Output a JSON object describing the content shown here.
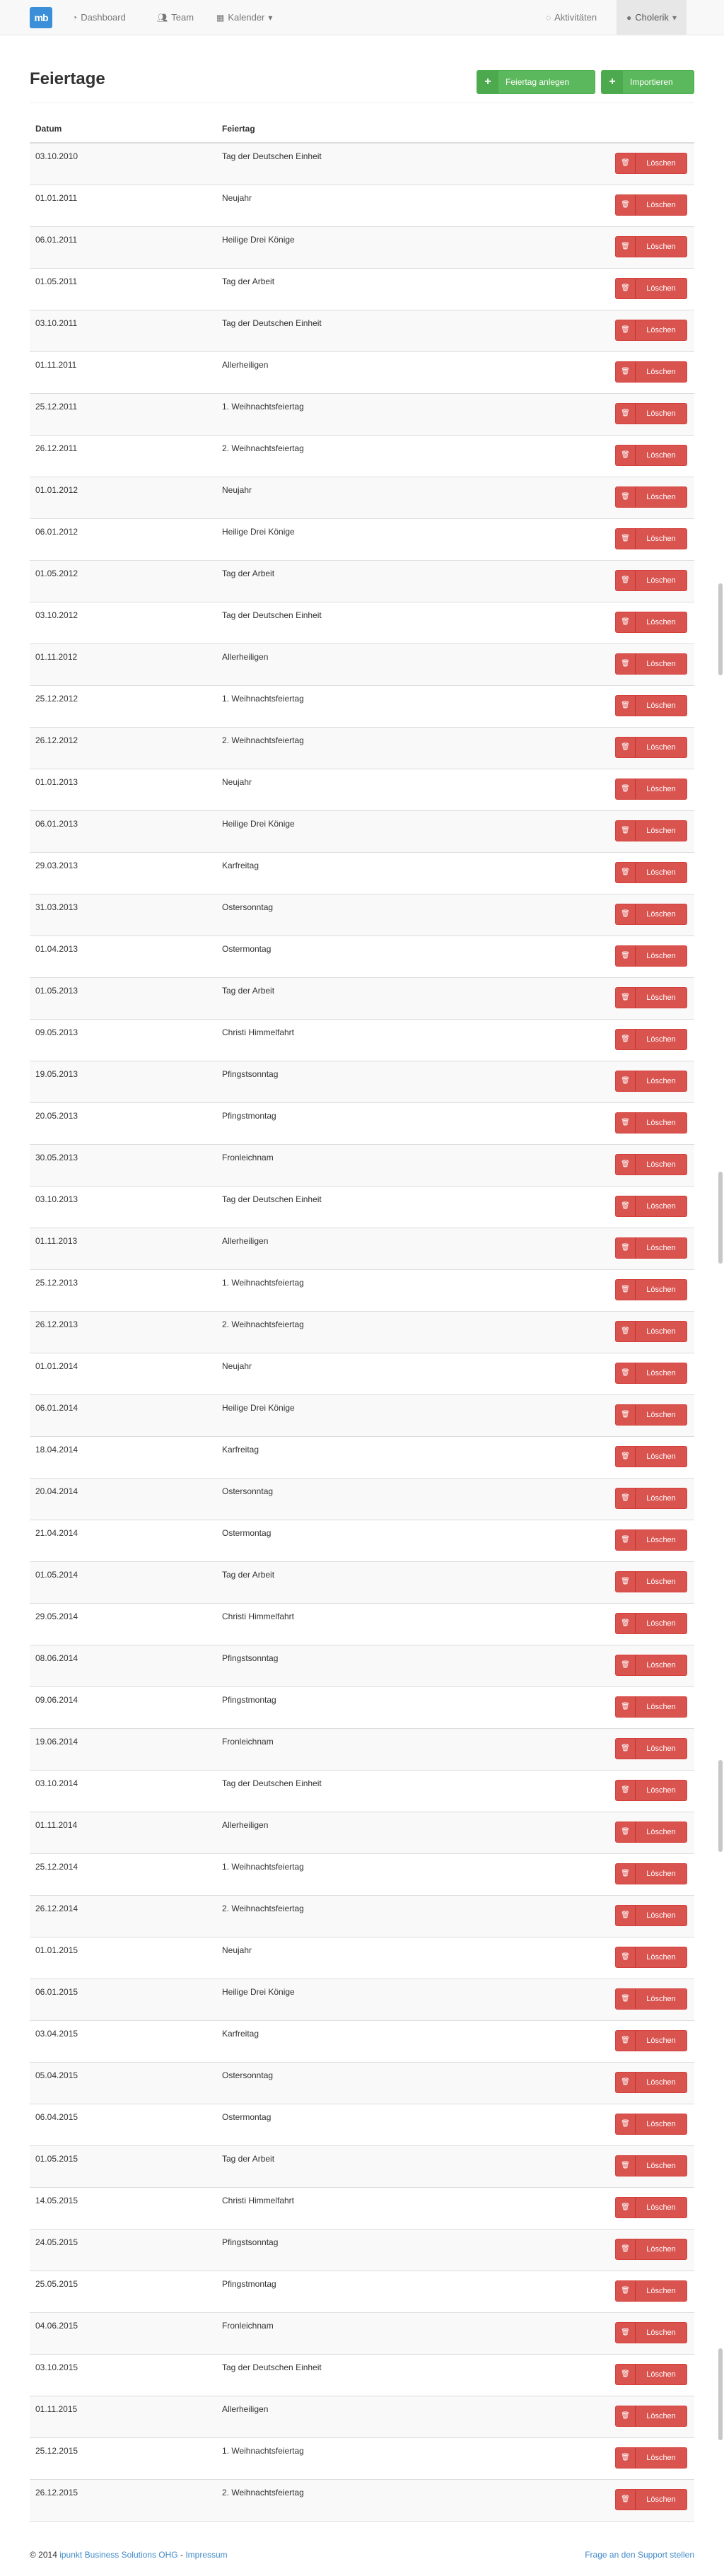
{
  "brand": {
    "logo": "mb"
  },
  "nav": {
    "dashboard": "Dashboard",
    "team": "Team",
    "kalender": "Kalender",
    "aktivitaeten": "Aktivitäten",
    "user": "Cholerik"
  },
  "page": {
    "title": "Feiertage",
    "btn_add": "Feiertag anlegen",
    "btn_import": "Importieren"
  },
  "table": {
    "col_date": "Datum",
    "col_name": "Feiertag",
    "delete_label": "Löschen",
    "rows": [
      [
        "03.10.2010",
        "Tag der Deutschen Einheit"
      ],
      [
        "01.01.2011",
        "Neujahr"
      ],
      [
        "06.01.2011",
        "Heilige Drei Könige"
      ],
      [
        "01.05.2011",
        "Tag der Arbeit"
      ],
      [
        "03.10.2011",
        "Tag der Deutschen Einheit"
      ],
      [
        "01.11.2011",
        "Allerheiligen"
      ],
      [
        "25.12.2011",
        "1. Weihnachtsfeiertag"
      ],
      [
        "26.12.2011",
        "2. Weihnachtsfeiertag"
      ],
      [
        "01.01.2012",
        "Neujahr"
      ],
      [
        "06.01.2012",
        "Heilige Drei Könige"
      ],
      [
        "01.05.2012",
        "Tag der Arbeit"
      ],
      [
        "03.10.2012",
        "Tag der Deutschen Einheit"
      ],
      [
        "01.11.2012",
        "Allerheiligen"
      ],
      [
        "25.12.2012",
        "1. Weihnachtsfeiertag"
      ],
      [
        "26.12.2012",
        "2. Weihnachtsfeiertag"
      ],
      [
        "01.01.2013",
        "Neujahr"
      ],
      [
        "06.01.2013",
        "Heilige Drei Könige"
      ],
      [
        "29.03.2013",
        "Karfreitag"
      ],
      [
        "31.03.2013",
        "Ostersonntag"
      ],
      [
        "01.04.2013",
        "Ostermontag"
      ],
      [
        "01.05.2013",
        "Tag der Arbeit"
      ],
      [
        "09.05.2013",
        "Christi Himmelfahrt"
      ],
      [
        "19.05.2013",
        "Pfingstsonntag"
      ],
      [
        "20.05.2013",
        "Pfingstmontag"
      ],
      [
        "30.05.2013",
        "Fronleichnam"
      ],
      [
        "03.10.2013",
        "Tag der Deutschen Einheit"
      ],
      [
        "01.11.2013",
        "Allerheiligen"
      ],
      [
        "25.12.2013",
        "1. Weihnachtsfeiertag"
      ],
      [
        "26.12.2013",
        "2. Weihnachtsfeiertag"
      ],
      [
        "01.01.2014",
        "Neujahr"
      ],
      [
        "06.01.2014",
        "Heilige Drei Könige"
      ],
      [
        "18.04.2014",
        "Karfreitag"
      ],
      [
        "20.04.2014",
        "Ostersonntag"
      ],
      [
        "21.04.2014",
        "Ostermontag"
      ],
      [
        "01.05.2014",
        "Tag der Arbeit"
      ],
      [
        "29.05.2014",
        "Christi Himmelfahrt"
      ],
      [
        "08.06.2014",
        "Pfingstsonntag"
      ],
      [
        "09.06.2014",
        "Pfingstmontag"
      ],
      [
        "19.06.2014",
        "Fronleichnam"
      ],
      [
        "03.10.2014",
        "Tag der Deutschen Einheit"
      ],
      [
        "01.11.2014",
        "Allerheiligen"
      ],
      [
        "25.12.2014",
        "1. Weihnachtsfeiertag"
      ],
      [
        "26.12.2014",
        "2. Weihnachtsfeiertag"
      ],
      [
        "01.01.2015",
        "Neujahr"
      ],
      [
        "06.01.2015",
        "Heilige Drei Könige"
      ],
      [
        "03.04.2015",
        "Karfreitag"
      ],
      [
        "05.04.2015",
        "Ostersonntag"
      ],
      [
        "06.04.2015",
        "Ostermontag"
      ],
      [
        "01.05.2015",
        "Tag der Arbeit"
      ],
      [
        "14.05.2015",
        "Christi Himmelfahrt"
      ],
      [
        "24.05.2015",
        "Pfingstsonntag"
      ],
      [
        "25.05.2015",
        "Pfingstmontag"
      ],
      [
        "04.06.2015",
        "Fronleichnam"
      ],
      [
        "03.10.2015",
        "Tag der Deutschen Einheit"
      ],
      [
        "01.11.2015",
        "Allerheiligen"
      ],
      [
        "25.12.2015",
        "1. Weihnachtsfeiertag"
      ],
      [
        "26.12.2015",
        "2. Weihnachtsfeiertag"
      ]
    ]
  },
  "footer": {
    "copyright": "© 2014",
    "company": "ipunkt Business Solutions OHG",
    "separator": " - ",
    "impressum": "Impressum",
    "support": "Frage an den Support stellen"
  },
  "colors": {
    "primary": "#3a8fd8",
    "success": "#5cb85c",
    "danger": "#d9534f",
    "link": "#428bca"
  },
  "icons": {
    "dashboard": "dashboard-icon",
    "team": "users-icon",
    "kalender": "calendar-icon",
    "aktivitaeten": "comment-icon",
    "user": "user-icon",
    "add": "plus-icon",
    "delete": "trash-icon"
  }
}
